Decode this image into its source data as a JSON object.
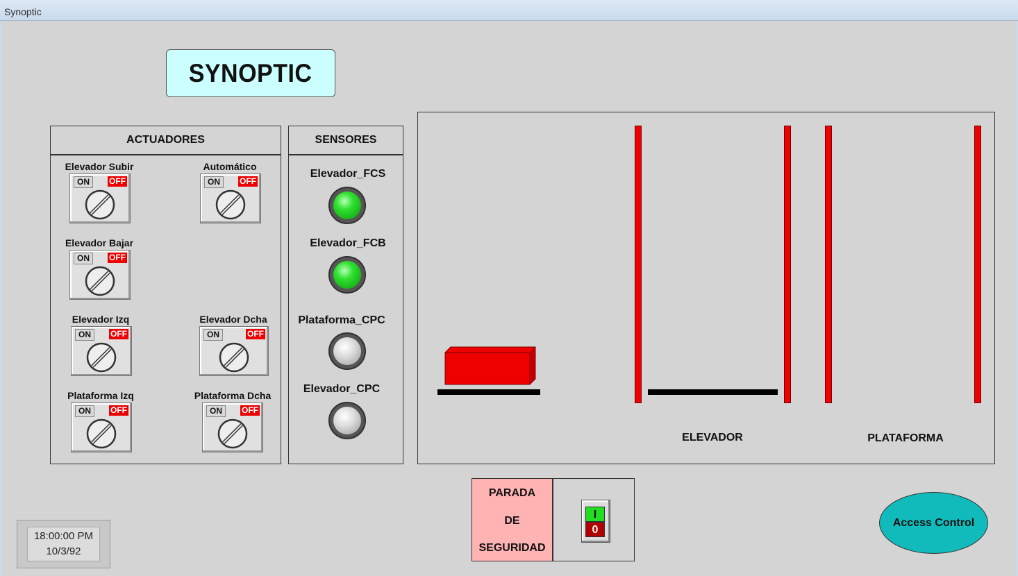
{
  "window": {
    "title": "Synoptic"
  },
  "header": {
    "title": "SYNOPTIC"
  },
  "actuators": {
    "heading": "ACTUADORES",
    "on_label": "ON",
    "off_label": "OFF",
    "items": [
      {
        "label": "Elevador Subir",
        "state": "OFF"
      },
      {
        "label": "Automático",
        "state": "OFF"
      },
      {
        "label": "Elevador Bajar",
        "state": "OFF"
      },
      {
        "label": "Elevador Izq",
        "state": "OFF"
      },
      {
        "label": "Elevador Dcha",
        "state": "OFF"
      },
      {
        "label": "Plataforma Izq",
        "state": "OFF"
      },
      {
        "label": "Plataforma Dcha",
        "state": "OFF"
      }
    ]
  },
  "sensors": {
    "heading": "SENSORES",
    "items": [
      {
        "label": "Elevador_FCS",
        "state": "on",
        "color": "#22dd22"
      },
      {
        "label": "Elevador_FCB",
        "state": "on",
        "color": "#22dd22"
      },
      {
        "label": "Plataforma_CPC",
        "state": "off",
        "color": "#dcdcdc"
      },
      {
        "label": "Elevador_CPC",
        "state": "off",
        "color": "#dcdcdc"
      }
    ]
  },
  "synoptic": {
    "elevator_label": "ELEVADOR",
    "platform_label": "PLATAFORMA",
    "box_color": "#ee0000",
    "rail_color": "#000000"
  },
  "emergency_stop": {
    "line1": "PARADA",
    "line2": "DE",
    "line3": "SEGURIDAD",
    "toggle_on": "I",
    "toggle_off": "0"
  },
  "access_control": {
    "label": "Access Control"
  },
  "clock": {
    "time": "18:00:00 PM",
    "date": "10/3/92"
  }
}
